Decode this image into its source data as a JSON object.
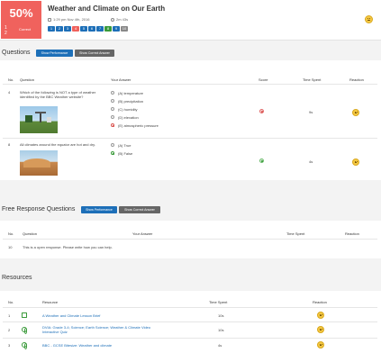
{
  "header": {
    "score_percent": "50%",
    "score_fraction_top": "1",
    "score_fraction_bottom": "2",
    "score_label": "Correct",
    "title": "Weather and Climate on Our Earth",
    "date": "1:29 pm Nov 4th, 2016",
    "duration": "2m 43s",
    "question_nav": [
      {
        "n": "1",
        "color": "#1d6fb8"
      },
      {
        "n": "2",
        "color": "#1d6fb8"
      },
      {
        "n": "3",
        "color": "#1d6fb8"
      },
      {
        "n": "4",
        "color": "#f0625d"
      },
      {
        "n": "5",
        "color": "#1d6fb8"
      },
      {
        "n": "6",
        "color": "#1d6fb8"
      },
      {
        "n": "7",
        "color": "#1d6fb8"
      },
      {
        "n": "8",
        "color": "#3a9a3a"
      },
      {
        "n": "9",
        "color": "#1d6fb8"
      },
      {
        "n": "10",
        "color": "#888888"
      }
    ]
  },
  "questions": {
    "heading": "Questions",
    "btn_performance": "Show Performance",
    "btn_correct": "Show Correct Answer",
    "columns": {
      "no": "No.",
      "question": "Question",
      "answer": "Your Answer",
      "score": "Score",
      "time": "Time Spent",
      "reaction": "Reaction"
    },
    "rows": [
      {
        "no": "4",
        "text": "Which of the following is NOT a type of weather identified by the BBC Weather website?",
        "options": [
          "(A) temperature",
          "(B) precipitation",
          "(C) humidity",
          "(D) elevation",
          "(E) atmospheric pressure"
        ],
        "time": "9s"
      },
      {
        "no": "8",
        "text": "All climates around the equator are hot and dry.",
        "options": [
          "(A) True",
          "(B) False"
        ],
        "time": "4s"
      }
    ]
  },
  "free_response": {
    "heading": "Free Response Questions",
    "btn_performance": "Show Performance",
    "btn_correct": "Show Correct Answer",
    "columns": {
      "no": "No.",
      "question": "Question",
      "answer": "Your Answer",
      "time": "Time Spent",
      "reaction": "Reaction"
    },
    "rows": [
      {
        "no": "10",
        "text": "This is a open response. Please write how you can help."
      }
    ]
  },
  "resources": {
    "heading": "Resources",
    "columns": {
      "no": "No.",
      "resource": "Resource",
      "time": "Time Spent",
      "reaction": "Reaction"
    },
    "rows": [
      {
        "no": "1",
        "name": "A Weather and Climate Lesson Brief",
        "time": "10s",
        "icon": "document-icon"
      },
      {
        "no": "2",
        "name": "DVIA: Grade 3-4; Science; Earth Science; Weather & Climate Video Interactive Quiz",
        "time": "10s",
        "icon": "globe-icon"
      },
      {
        "no": "3",
        "name": "BBC - GCSE Bitesize: Weather and climate",
        "time": "4s",
        "icon": "globe-icon"
      }
    ]
  }
}
